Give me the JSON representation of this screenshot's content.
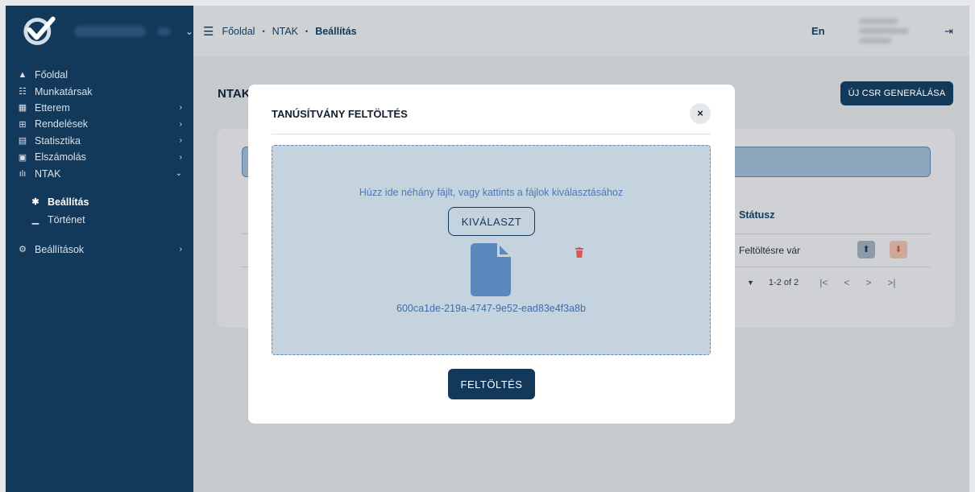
{
  "sidebar": {
    "menu": [
      {
        "icon": "home-icon",
        "glyph": "▲",
        "label": "Főoldal",
        "chevron": ""
      },
      {
        "icon": "users-icon",
        "glyph": "☷",
        "label": "Munkatársak",
        "chevron": ""
      },
      {
        "icon": "restaurant-icon",
        "glyph": "▦",
        "label": "Etterem",
        "chevron": "›"
      },
      {
        "icon": "cart-icon",
        "glyph": "⊞",
        "label": "Rendelések",
        "chevron": "›"
      },
      {
        "icon": "chart-icon",
        "glyph": "▤",
        "label": "Statisztika",
        "chevron": "›"
      },
      {
        "icon": "receipt-icon",
        "glyph": "▣",
        "label": "Elszámolás",
        "chevron": "›"
      },
      {
        "icon": "signal-icon",
        "glyph": "ılı",
        "label": "NTAK",
        "chevron": "⌄"
      }
    ],
    "submenu": [
      {
        "icon": "gear-icon",
        "glyph": "✱",
        "label": "Beállítás"
      },
      {
        "icon": "history-chart-icon",
        "glyph": "▁",
        "label": "Történet"
      }
    ],
    "settings": {
      "icon": "cogs-icon",
      "glyph": "⚙",
      "label": "Beállítások",
      "chevron": "›"
    }
  },
  "header": {
    "breadcrumbs": [
      "Főoldal",
      "NTAK",
      "Beállítás"
    ],
    "separator": "•",
    "lang": "En",
    "logout_glyph": "⇥"
  },
  "page": {
    "title": "NTAK",
    "new_csr_button": "ÚJ CSR GENERÁLÁSA",
    "table": {
      "status_header": "Státusz",
      "status_value": "Feltöltésre vár",
      "pagination": {
        "range": "1-2 of 2",
        "first": "|<",
        "prev": "<",
        "next": ">",
        "last": ">|"
      }
    }
  },
  "modal": {
    "title": "TANÚSÍTVÁNY FELTÖLTÉS",
    "close": "×",
    "dropzone_text": "Húzz ide néhány fájlt, vagy kattints a fájlok kiválasztásához",
    "select_button": "KIVÁLASZT",
    "file_name": "600ca1de-219a-4747-9e52-ead83e4f3a8b",
    "upload_button": "FELTÖLTÉS"
  },
  "colors": {
    "primary": "#12385a",
    "file_icon": "#5b88bd",
    "trash": "#e05555",
    "dropzone": "#c5d3df"
  }
}
